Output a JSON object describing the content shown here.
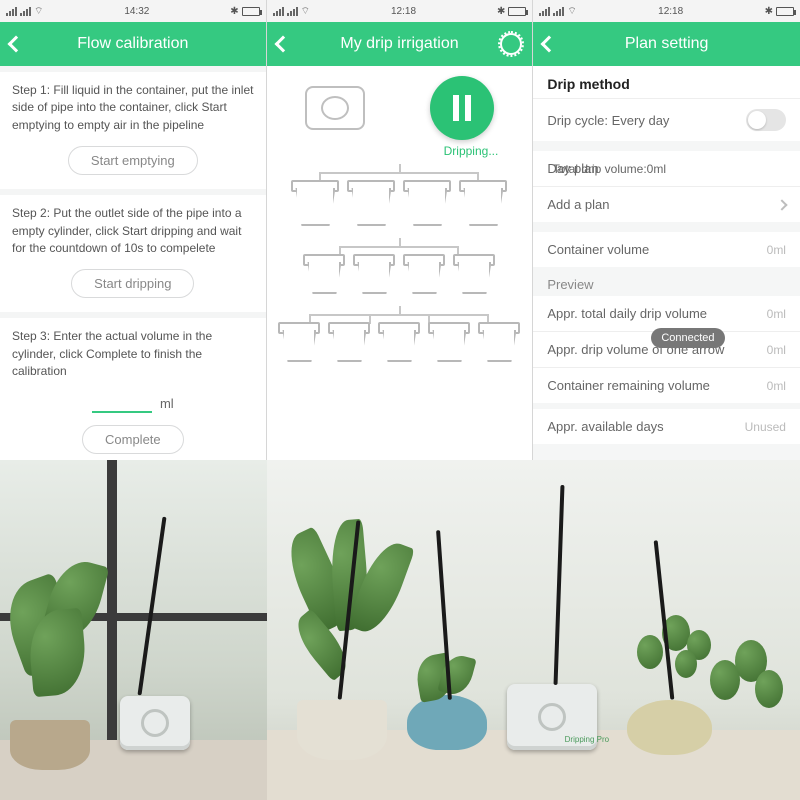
{
  "screen1": {
    "time": "14:32",
    "title": "Flow calibration",
    "step1_text": "Step 1: Fill liquid in the container, put the inlet side of pipe into the container, click Start emptying to empty air in the pipeline",
    "step1_btn": "Start emptying",
    "step2_text": "Step 2: Put the outlet side of the pipe into a empty cylinder, click Start dripping and wait for the countdown of 10s to compelete",
    "step2_btn": "Start dripping",
    "step3_text": "Step 3: Enter the actual volume in the cylinder, click Complete to finish the calibration",
    "ml_unit": "ml",
    "step3_btn": "Complete"
  },
  "screen2": {
    "time": "12:18",
    "title": "My drip irrigation",
    "status": "Dripping..."
  },
  "screen3": {
    "time": "12:18",
    "title": "Plan setting",
    "drip_method_hd": "Drip method",
    "drip_cycle_label": "Drip cycle: Every day",
    "day_plan_label": "Day plan",
    "day_plan_sub": "Total drip volume:0ml",
    "add_plan": "Add a plan",
    "container_volume_label": "Container volume",
    "container_volume_val": "0ml",
    "preview_hd": "Preview",
    "row1_label": "Appr. total daily drip volume",
    "row1_val": "0ml",
    "row2_label": "Appr. drip volume of one arrow",
    "row2_val": "0ml",
    "row3_label": "Container remaining volume",
    "row3_val": "0ml",
    "row4_label": "Appr. available days",
    "row4_val": "Unused",
    "toast": "Connected"
  }
}
